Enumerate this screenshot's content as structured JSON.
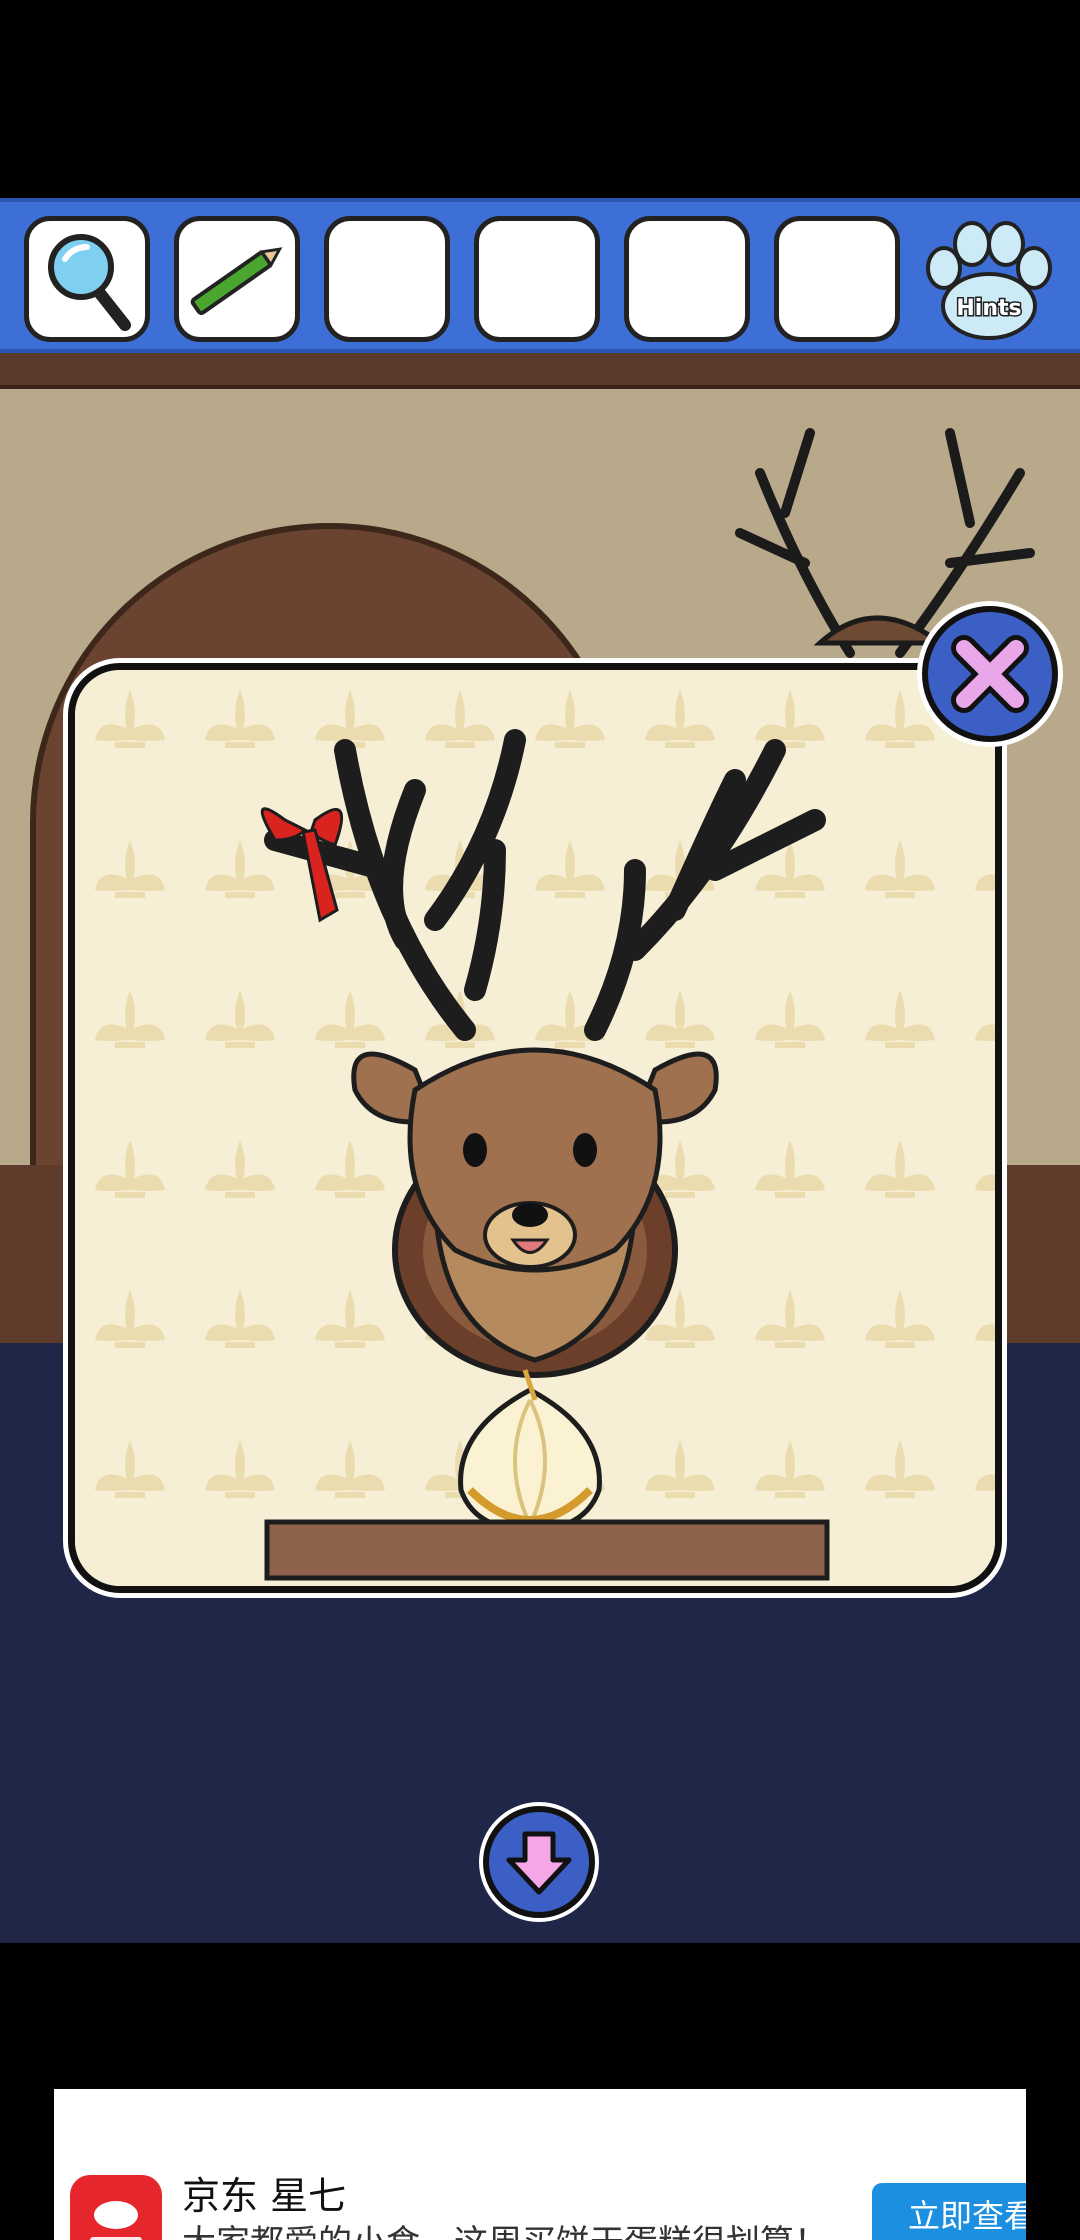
{
  "inventory": {
    "slots": [
      {
        "item": "magnifying-glass-icon"
      },
      {
        "item": "green-pencil-icon"
      },
      {
        "item": "empty"
      },
      {
        "item": "empty"
      },
      {
        "item": "empty"
      },
      {
        "item": "empty"
      }
    ],
    "hints_label": "Hints"
  },
  "colors": {
    "inventory_bar": "#3d6fd6",
    "button_blue": "#3b5fc4",
    "close_x": "#e9a6e8",
    "down_arrow": "#f4a6e6",
    "wallpaper": "#f6efd6",
    "floor": "#1f2648",
    "ad_button": "#1d8fe0",
    "ad_icon": "#e6262d"
  },
  "zoom_view": {
    "subject": "mounted-deer-head",
    "items_visible": [
      "red-ribbon",
      "onion"
    ]
  },
  "buttons": {
    "close": "close-icon",
    "back": "arrow-down-icon"
  },
  "ad": {
    "title": "京东 星七",
    "description": "大家都爱的小食，这周买饼干蛋糕很划算！",
    "cta": "立即查看"
  }
}
